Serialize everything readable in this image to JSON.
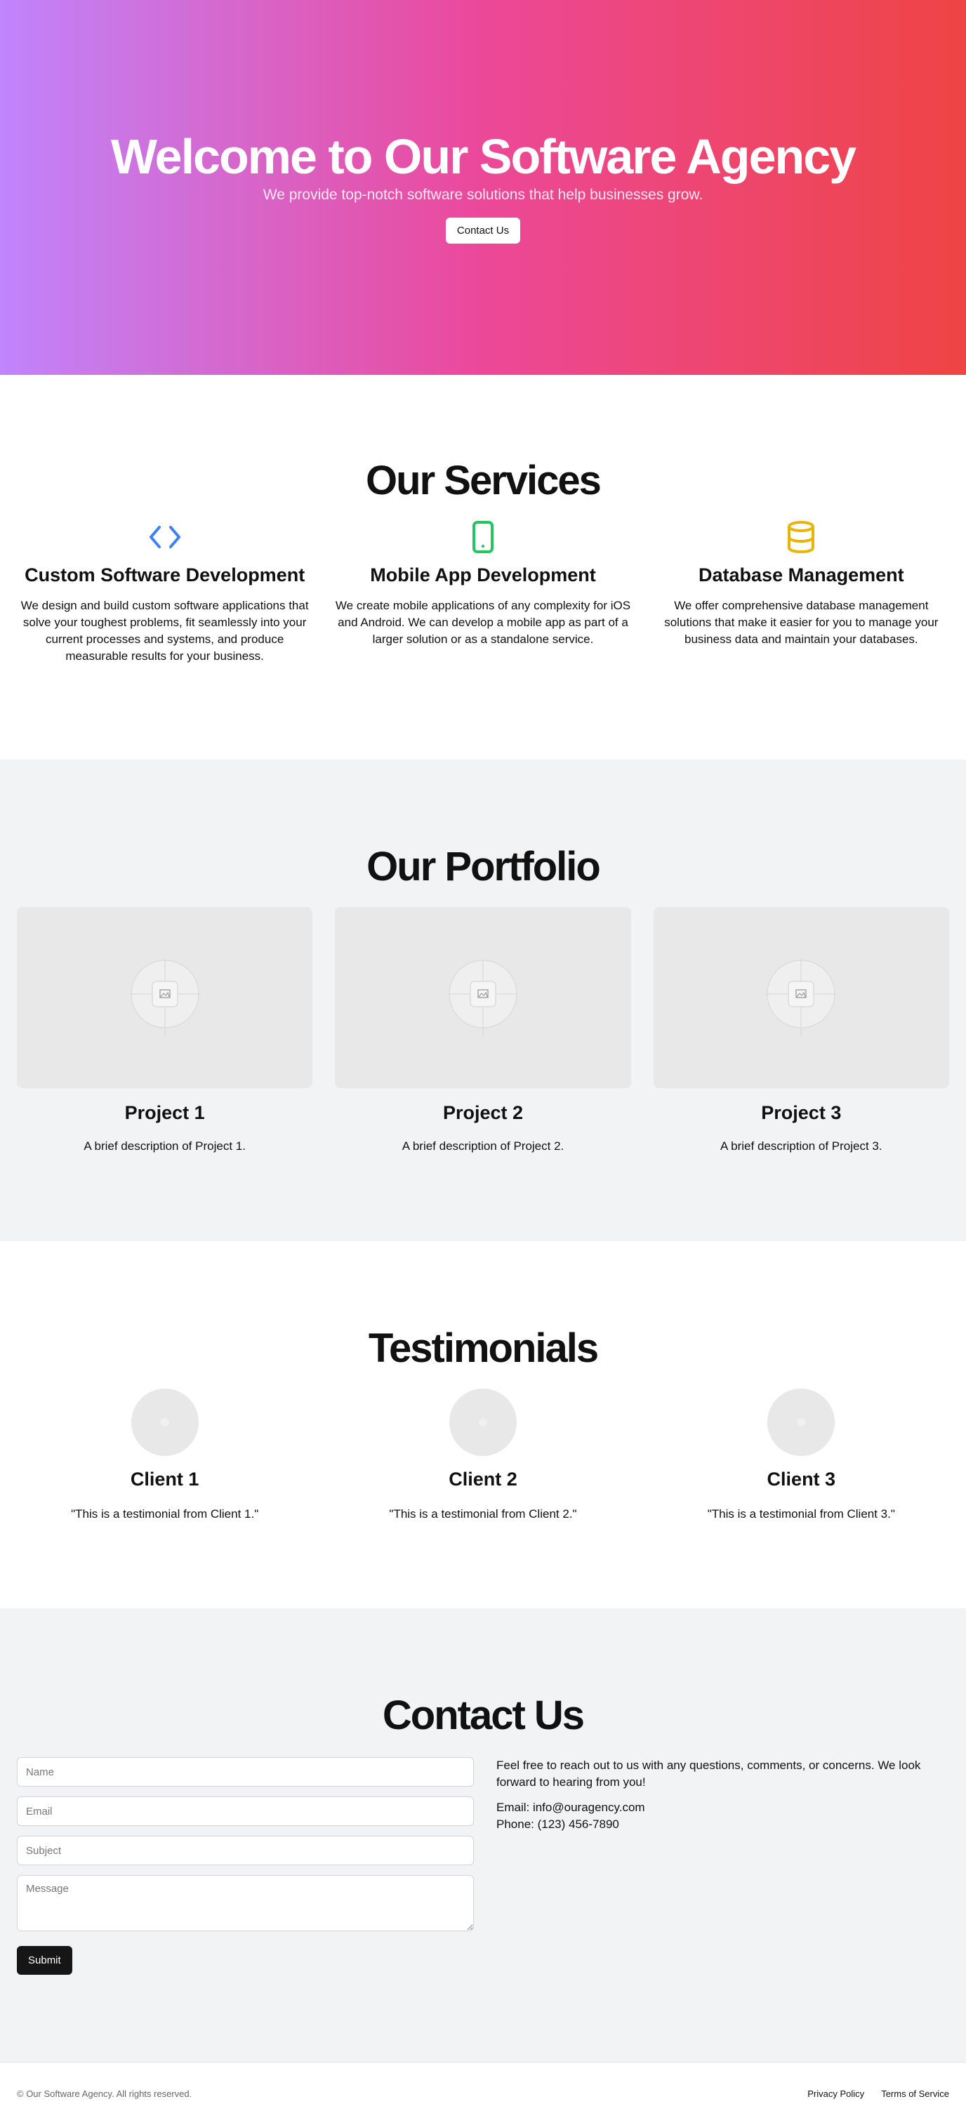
{
  "hero": {
    "title": "Welcome to Our Software Agency",
    "subtitle": "We provide top-notch software solutions that help businesses grow.",
    "cta_label": "Contact Us"
  },
  "services": {
    "title": "Our Services",
    "items": [
      {
        "icon": "code-icon",
        "color": "#3b82f6",
        "title": "Custom Software Development",
        "description": "We design and build custom software applications that solve your toughest problems, fit seamlessly into your current processes and systems, and produce measurable results for your business."
      },
      {
        "icon": "mobile-icon",
        "color": "#22c55e",
        "title": "Mobile App Development",
        "description": "We create mobile applications of any complexity for iOS and Android. We can develop a mobile app as part of a larger solution or as a standalone service."
      },
      {
        "icon": "database-icon",
        "color": "#eab308",
        "title": "Database Management",
        "description": "We offer comprehensive database management solutions that make it easier for you to manage your business data and maintain your databases."
      }
    ]
  },
  "portfolio": {
    "title": "Our Portfolio",
    "items": [
      {
        "title": "Project 1",
        "description": "A brief description of Project 1."
      },
      {
        "title": "Project 2",
        "description": "A brief description of Project 2."
      },
      {
        "title": "Project 3",
        "description": "A brief description of Project 3."
      }
    ]
  },
  "testimonials": {
    "title": "Testimonials",
    "items": [
      {
        "name": "Client 1",
        "quote": "\"This is a testimonial from Client 1.\""
      },
      {
        "name": "Client 2",
        "quote": "\"This is a testimonial from Client 2.\""
      },
      {
        "name": "Client 3",
        "quote": "\"This is a testimonial from Client 3.\""
      }
    ]
  },
  "contact": {
    "title": "Contact Us",
    "fields": {
      "name_placeholder": "Name",
      "email_placeholder": "Email",
      "subject_placeholder": "Subject",
      "message_placeholder": "Message"
    },
    "submit_label": "Submit",
    "intro": "Feel free to reach out to us with any questions, comments, or concerns. We look forward to hearing from you!",
    "email": "Email: info@ouragency.com",
    "phone": "Phone: (123) 456-7890"
  },
  "footer": {
    "copyright": "© Our Software Agency. All rights reserved.",
    "privacy": "Privacy Policy",
    "terms": "Terms of Service"
  },
  "colors": {
    "gradient_start": "#c084fc",
    "gradient_mid": "#ec4899",
    "gradient_end": "#ef4444",
    "section_alt_bg": "#f2f3f5"
  }
}
